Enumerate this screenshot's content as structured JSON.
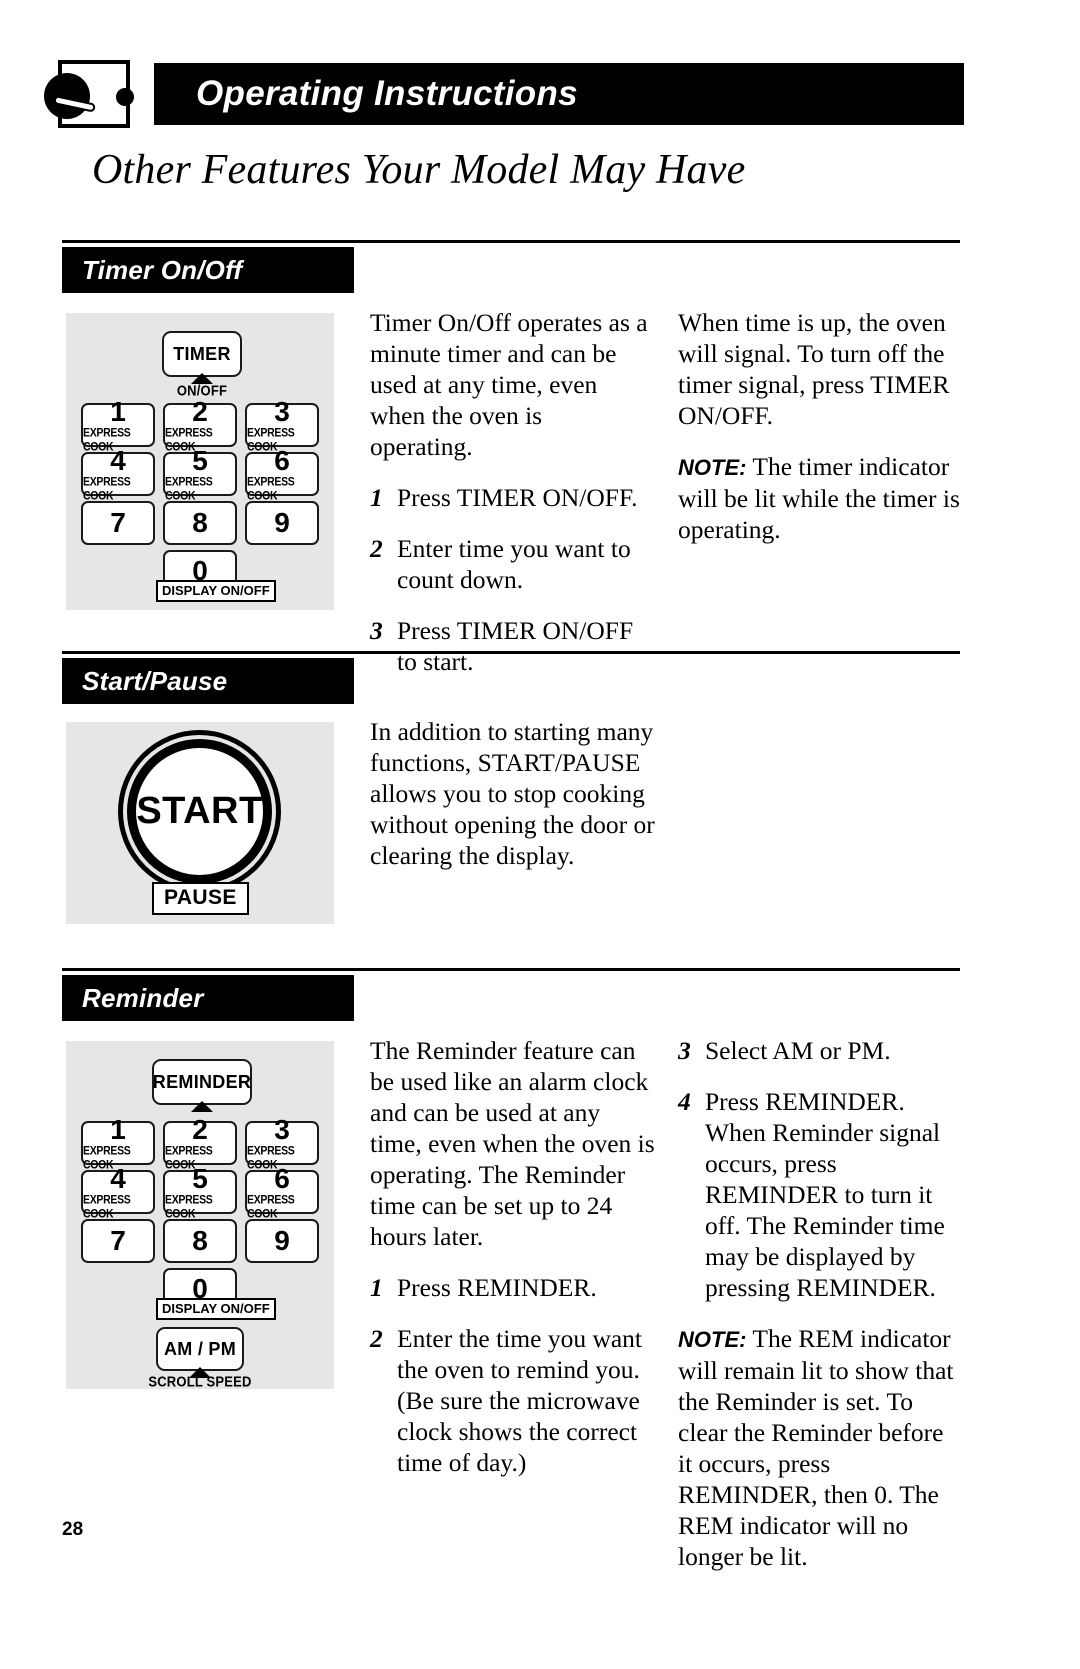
{
  "header": {
    "icon": "microwave-oven-dial-icon",
    "title": "Operating Instructions",
    "subtitle": "Other Features Your Model May Have"
  },
  "page_number": "28",
  "keypad": {
    "express_cook_label": "EXPRESS COOK",
    "display_on_off_label": "DISPLAY ON/OFF",
    "digits": [
      "1",
      "2",
      "3",
      "4",
      "5",
      "6",
      "7",
      "8",
      "9",
      "0"
    ]
  },
  "sections": [
    {
      "id": "timer-on-off",
      "title": "Timer On/Off",
      "keypad": {
        "top_key_label": "TIMER",
        "top_key_caption": "ON/OFF"
      },
      "column_left": {
        "intro": "Timer On/Off operates as a minute timer and can be used at any time, even when the oven is operating.",
        "steps": [
          {
            "num": "1",
            "text": "Press TIMER ON/OFF."
          },
          {
            "num": "2",
            "text": "Enter time you want to count down."
          },
          {
            "num": "3",
            "text": "Press TIMER ON/OFF to start."
          }
        ]
      },
      "column_right": {
        "paragraph": "When time is up, the oven will signal. To turn off the timer signal, press TIMER ON/OFF.",
        "note_label": "NOTE:",
        "note_text": "The timer indicator will be lit while the timer is operating."
      }
    },
    {
      "id": "start-pause",
      "title": "Start/Pause",
      "button": {
        "start_label": "START",
        "pause_label": "PAUSE"
      },
      "column_left": {
        "paragraph": "In addition to starting many functions, START/PAUSE allows you to stop cooking without opening the door or clearing the display."
      }
    },
    {
      "id": "reminder",
      "title": "Reminder",
      "keypad": {
        "top_key_label": "REMINDER",
        "am_pm_label": "AM / PM",
        "scroll_speed_label": "SCROLL SPEED"
      },
      "column_left": {
        "intro": "The Reminder feature can be used like an alarm clock and can be used at any time, even when the oven is operating. The Reminder time can be set up to 24 hours later.",
        "steps": [
          {
            "num": "1",
            "text": "Press REMINDER."
          },
          {
            "num": "2",
            "text": "Enter the time you want the oven to remind you. (Be sure the microwave clock shows the correct time of day.)"
          }
        ]
      },
      "column_right": {
        "steps": [
          {
            "num": "3",
            "text": "Select AM or PM."
          },
          {
            "num": "4",
            "text": "Press REMINDER. When Reminder signal occurs, press REMINDER to turn it off. The Reminder time may be displayed by pressing REMINDER."
          }
        ],
        "note_label": "NOTE:",
        "note_text": "The REM indicator will remain lit to show that the Reminder is set. To clear the Reminder before it occurs, press REMINDER, then 0. The REM indicator will no longer be lit."
      }
    }
  ]
}
